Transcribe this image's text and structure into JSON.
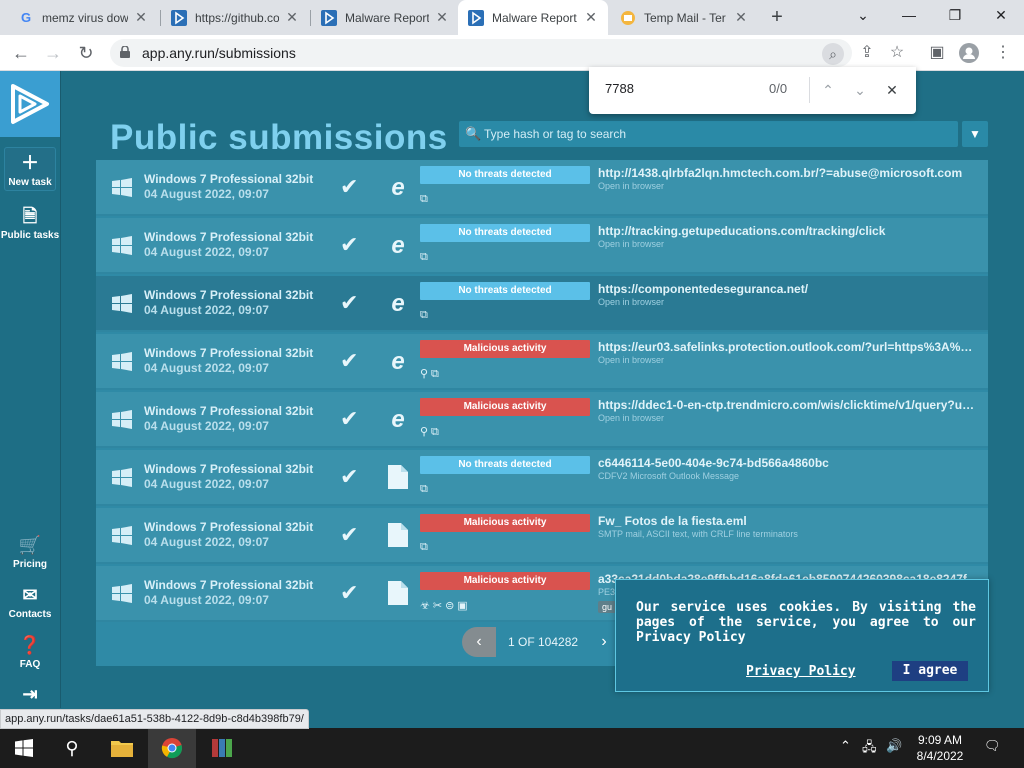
{
  "browser": {
    "tabs": [
      {
        "title": "memz virus dow",
        "icon": "G",
        "icon_color": "#4285f4",
        "active": false
      },
      {
        "title": "https://github.co",
        "icon": "github-icon",
        "active": false
      },
      {
        "title": "Malware Report",
        "icon": "anyrun-icon",
        "active": false
      },
      {
        "title": "Malware Report",
        "icon": "anyrun-icon",
        "active": true
      },
      {
        "title": "Temp Mail - Ter",
        "icon": "tempmail-icon",
        "active": false
      }
    ],
    "url": "app.any.run/submissions",
    "find": {
      "query": "7788",
      "count": "0/0"
    },
    "status_url": "app.any.run/tasks/dae61a51-538b-4122-8d9b-c8d4b398fb79/"
  },
  "sidebar": {
    "items": [
      {
        "label": "New task",
        "icon": "plus-icon"
      },
      {
        "label": "Public tasks",
        "icon": "document-icon"
      },
      {
        "label": "Pricing",
        "icon": "cart-icon"
      },
      {
        "label": "Contacts",
        "icon": "mail-icon"
      },
      {
        "label": "FAQ",
        "icon": "question-icon"
      }
    ]
  },
  "main": {
    "title": "Public submissions",
    "search_placeholder": "Type hash or tag to search",
    "rows": [
      {
        "os": "Windows 7 Professional 32bit",
        "date": "04 August 2022, 09:07",
        "app": "ie",
        "verdict": "No threats detected",
        "verdict_type": "clean",
        "tags": "⧉",
        "target": "http://1438.qlrbfa2lqn.hmctech.com.br/?=abuse@microsoft.com",
        "sub": "Open in browser"
      },
      {
        "os": "Windows 7 Professional 32bit",
        "date": "04 August 2022, 09:07",
        "app": "ie",
        "verdict": "No threats detected",
        "verdict_type": "clean",
        "tags": "⧉",
        "target": "http://tracking.getupeducations.com/tracking/click",
        "sub": "Open in browser"
      },
      {
        "os": "Windows 7 Professional 32bit",
        "date": "04 August 2022, 09:07",
        "app": "ie",
        "verdict": "No threats detected",
        "verdict_type": "clean",
        "tags": "⧉",
        "target": "https://componentedeseguranca.net/",
        "sub": "Open in browser"
      },
      {
        "os": "Windows 7 Professional 32bit",
        "date": "04 August 2022, 09:07",
        "app": "ie",
        "verdict": "Malicious activity",
        "verdict_type": "malicious",
        "tags": "⚲⧉",
        "target": "https://eur03.safelinks.protection.outlook.com/?url=https%3A%2F%...",
        "sub": "Open in browser"
      },
      {
        "os": "Windows 7 Professional 32bit",
        "date": "04 August 2022, 09:07",
        "app": "ie",
        "verdict": "Malicious activity",
        "verdict_type": "malicious",
        "tags": "⚲⧉",
        "target": "https://ddec1-0-en-ctp.trendmicro.com/wis/clicktime/v1/query?url=...",
        "sub": "Open in browser"
      },
      {
        "os": "Windows 7 Professional 32bit",
        "date": "04 August 2022, 09:07",
        "app": "file",
        "verdict": "No threats detected",
        "verdict_type": "clean",
        "tags": "⧉",
        "target": "c6446114-5e00-404e-9c74-bd566a4860bc",
        "sub": "CDFV2 Microsoft Outlook Message"
      },
      {
        "os": "Windows 7 Professional 32bit",
        "date": "04 August 2022, 09:07",
        "app": "file",
        "verdict": "Malicious activity",
        "verdict_type": "malicious",
        "tags": "⧉",
        "target": "Fw_ Fotos de la fiesta.eml",
        "sub": "SMTP mail, ASCII text, with CRLF line terminators"
      },
      {
        "os": "Windows 7 Professional 32bit",
        "date": "04 August 2022, 09:07",
        "app": "file",
        "verdict": "Malicious activity",
        "verdict_type": "malicious",
        "tags": "☣✂⊜▣",
        "target": "a33ca21dd0bda28e9ffbbd16a8fda61eb8590744260398ca18e8247f",
        "sub": "PE3",
        "extra": "gu"
      }
    ],
    "pagination": {
      "text": "1 OF 104282"
    }
  },
  "cookie": {
    "text": "Our service uses cookies. By visiting the pages of the service, you agree to our Privacy Policy",
    "link": "Privacy Policy",
    "button": "I agree"
  },
  "taskbar": {
    "time": "9:09 AM",
    "date": "8/4/2022"
  },
  "colors": {
    "clean": "#5bc0e8",
    "malicious": "#d9534f",
    "accent": "#3a9ed1"
  }
}
